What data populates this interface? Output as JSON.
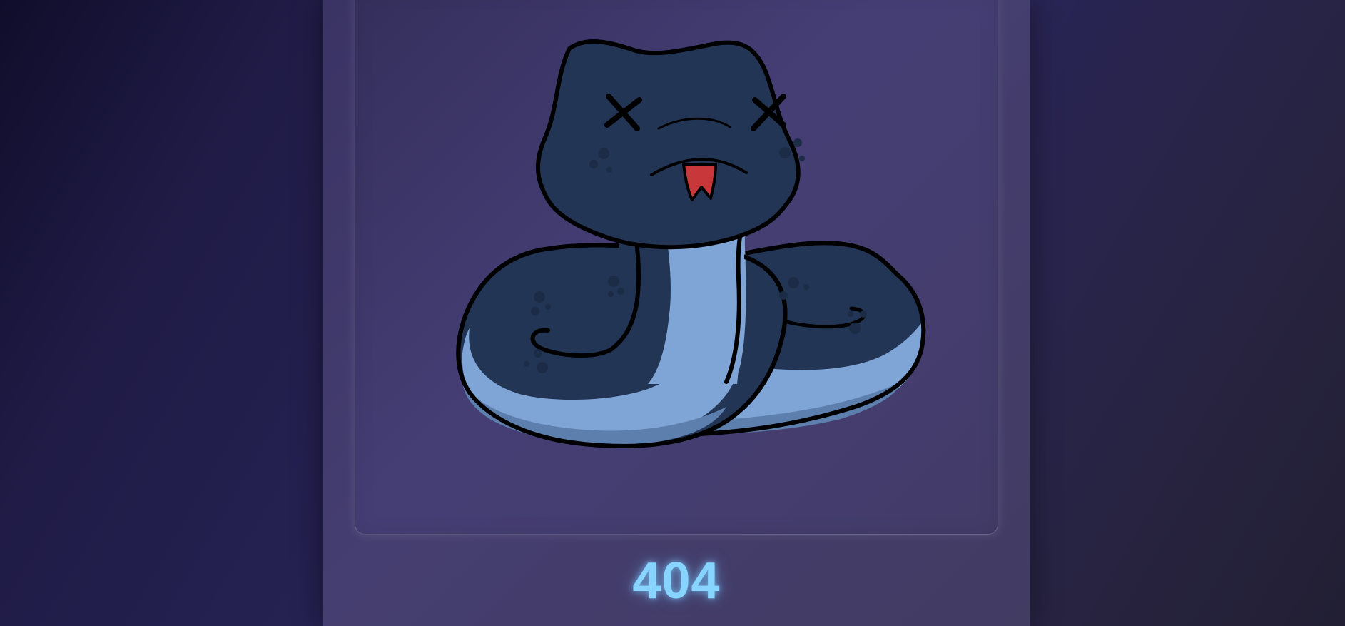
{
  "page": {
    "background_color": "#201c47"
  },
  "card": {
    "background_color": "#453e70"
  },
  "illustration": {
    "icon": "dead-snake-icon",
    "colors": {
      "body_dark": "#223555",
      "belly": "#7fa4d6",
      "belly_shadow": "#5d7fae",
      "spots": "#1c2c47",
      "tongue": "#c8383b",
      "outline": "#000000"
    }
  },
  "error": {
    "code": "404",
    "color": "#86d4ff"
  }
}
